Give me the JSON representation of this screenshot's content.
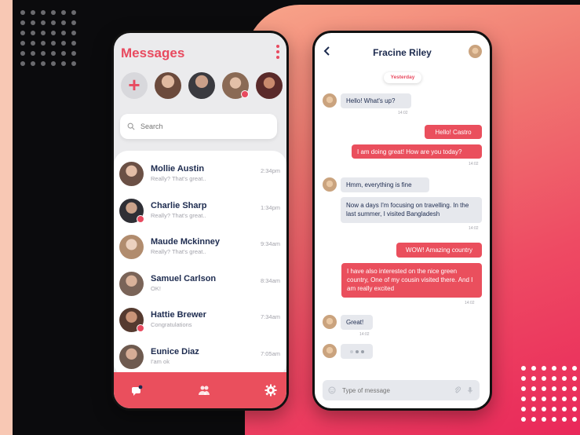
{
  "colors": {
    "accent": "#ea4f5d",
    "title": "#1d2b4f",
    "muted": "#a3a3ab"
  },
  "messages_screen": {
    "title": "Messages",
    "search_placeholder": "Search",
    "stories": [
      {
        "name": "story-1",
        "avatar_color": "#6b4a3c",
        "online": false
      },
      {
        "name": "story-2",
        "avatar_color": "#3a3a3f",
        "online": false
      },
      {
        "name": "story-3",
        "avatar_color": "#8a6a55",
        "online": true
      },
      {
        "name": "story-4",
        "avatar_color": "#5a2a2a",
        "online": false
      }
    ],
    "chats": [
      {
        "name": "Mollie Austin",
        "preview": "Really? That's great..",
        "time": "2:34pm",
        "avatar_color": "#6b5045",
        "online": false
      },
      {
        "name": "Charlie Sharp",
        "preview": "Really? That's great..",
        "time": "1:34pm",
        "avatar_color": "#2f2f35",
        "online": true
      },
      {
        "name": "Maude Mckinney",
        "preview": "Really? That's great..",
        "time": "9:34am",
        "avatar_color": "#b18c6e",
        "online": false
      },
      {
        "name": "Samuel Carlson",
        "preview": "OK!",
        "time": "8:34am",
        "avatar_color": "#7a6458",
        "online": false
      },
      {
        "name": "Hattie Brewer",
        "preview": "Congratulations",
        "time": "7:34am",
        "avatar_color": "#553a2f",
        "online": true
      },
      {
        "name": "Eunice Diaz",
        "preview": "I'am ok",
        "time": "7:05am",
        "avatar_color": "#6e5a4f",
        "online": false
      }
    ],
    "nav_icons": [
      "chat-icon",
      "contacts-icon",
      "settings-icon"
    ]
  },
  "conversation_screen": {
    "contact_name": "Fracine Riley",
    "date_label": "Yesterday",
    "input_placeholder": "Type of message",
    "messages": [
      {
        "dir": "in",
        "text": "Hello! What's up?",
        "time": "14:02"
      },
      {
        "dir": "out",
        "text": "Hello! Castro",
        "time": ""
      },
      {
        "dir": "out",
        "text": "I am doing great! How are you today?",
        "time": "14:02"
      },
      {
        "dir": "in",
        "text": "Hmm, everything is fine",
        "time": ""
      },
      {
        "dir": "in",
        "text": "Now a days I'm focusing on travelling. In the last summer, I visited Bangladesh",
        "time": "14:02"
      },
      {
        "dir": "out",
        "text": "WOW! Amazing country",
        "time": ""
      },
      {
        "dir": "out",
        "text": "I have also interested on the nice green country, One of my cousin visited there. And I am really excited",
        "time": "14:02"
      },
      {
        "dir": "in",
        "text": "Great!",
        "time": "14:02"
      }
    ]
  }
}
